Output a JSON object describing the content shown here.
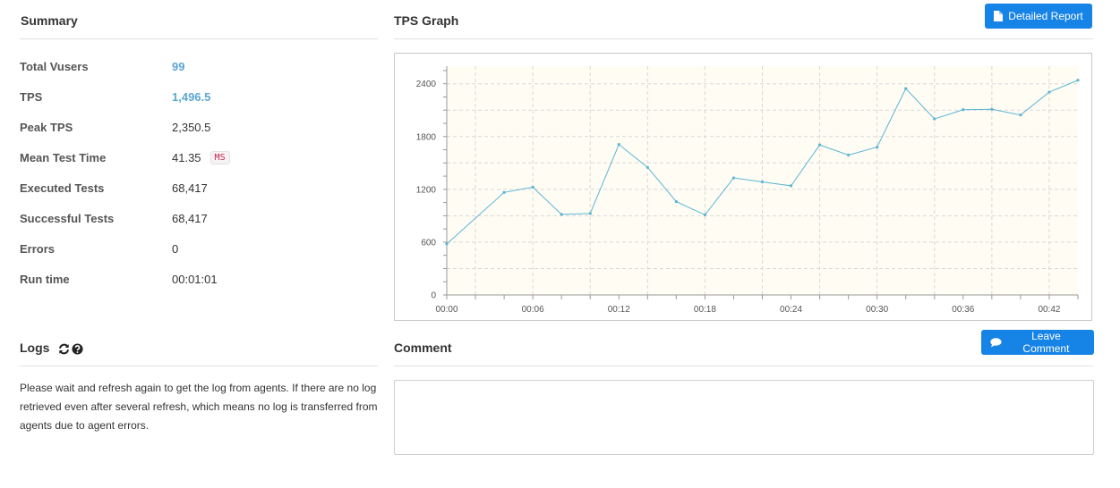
{
  "summary": {
    "title": "Summary",
    "rows": [
      {
        "label": "Total Vusers",
        "value": "99"
      },
      {
        "label": "TPS",
        "value": "1,496.5"
      },
      {
        "label": "Peak TPS",
        "value": "2,350.5"
      },
      {
        "label": "Mean Test Time",
        "value": "41.35",
        "unit": "MS"
      },
      {
        "label": "Executed Tests",
        "value": "68,417"
      },
      {
        "label": "Successful Tests",
        "value": "68,417"
      },
      {
        "label": "Errors",
        "value": "0"
      },
      {
        "label": "Run time",
        "value": "00:01:01"
      }
    ]
  },
  "tps_graph": {
    "title": "TPS Graph",
    "detailed_report_label": "Detailed Report"
  },
  "logs": {
    "title": "Logs",
    "message": "Please wait and refresh again to get the log from agents. If there are no log retrieved even after several refresh, which means no log is transferred from agents due to agent errors."
  },
  "comment": {
    "title": "Comment",
    "leave_comment_label": "Leave Comment",
    "value": ""
  },
  "colors": {
    "accent": "#1683e6",
    "link_value": "#5ba7d1",
    "series_line": "#5bb5d3",
    "plot_bg": "#fffcf4"
  },
  "chart_data": {
    "type": "line",
    "title": "",
    "xlabel": "",
    "ylabel": "",
    "x_unit_seconds": true,
    "xlim": [
      0,
      44
    ],
    "ylim": [
      0,
      2600
    ],
    "x_ticks": [
      "00:00",
      "00:06",
      "00:12",
      "00:18",
      "00:24",
      "00:30",
      "00:36",
      "00:42"
    ],
    "y_ticks": [
      "0",
      "600",
      "1200",
      "1800",
      "2400"
    ],
    "grid": true,
    "series": [
      {
        "x": [
          0,
          4,
          6,
          8,
          10,
          12,
          14,
          16,
          18,
          20,
          22,
          24,
          26,
          28,
          30,
          32,
          34,
          36,
          38,
          40,
          42,
          44
        ],
        "y": [
          580,
          1165,
          1225,
          915,
          925,
          1710,
          1450,
          1060,
          910,
          1330,
          1285,
          1240,
          1705,
          1590,
          1680,
          2345,
          2000,
          2105,
          2110,
          2045,
          2305,
          2440
        ]
      }
    ]
  }
}
